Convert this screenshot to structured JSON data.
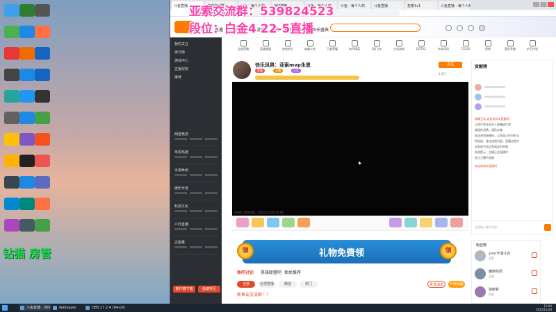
{
  "overlay": {
    "line1": "亚索交流群：539824523",
    "line2": "段位：白金4 22-5直播"
  },
  "desktop": {
    "bottom_label": "钻猫 房管",
    "icons": [
      {
        "label": "",
        "color": "#3da0e8"
      },
      {
        "label": "",
        "color": "#2e7d32"
      },
      {
        "label": "",
        "color": "#555"
      },
      {
        "label": "",
        "color": "#4caf50"
      },
      {
        "label": "",
        "color": "#1e88e5"
      },
      {
        "label": "",
        "color": "#ff7043"
      },
      {
        "label": "",
        "color": "#e53935"
      },
      {
        "label": "",
        "color": "#ef6c00"
      },
      {
        "label": "",
        "color": "#1565c0"
      },
      {
        "label": "",
        "color": "#444"
      },
      {
        "label": "",
        "color": "#1e88e5"
      },
      {
        "label": "",
        "color": "#1565c0"
      },
      {
        "label": "",
        "color": "#26a69a"
      },
      {
        "label": "",
        "color": "#2196f3"
      },
      {
        "label": "",
        "color": "#333"
      },
      {
        "label": "",
        "color": "#616161"
      },
      {
        "label": "",
        "color": "#1e88e5"
      },
      {
        "label": "",
        "color": "#43a047"
      },
      {
        "label": "",
        "color": "#ffc107"
      },
      {
        "label": "",
        "color": "#7e57c2"
      },
      {
        "label": "",
        "color": "#f4511e"
      },
      {
        "label": "",
        "color": "#ffb300"
      },
      {
        "label": "",
        "color": "#222"
      },
      {
        "label": "",
        "color": "#ef5350"
      },
      {
        "label": "",
        "color": "#37474f"
      },
      {
        "label": "",
        "color": "#1e88e5"
      },
      {
        "label": "",
        "color": "#5c6bc0"
      },
      {
        "label": "",
        "color": "#0288d1"
      },
      {
        "label": "",
        "color": "#00897b"
      },
      {
        "label": "",
        "color": "#ff7043"
      },
      {
        "label": "",
        "color": "#ab47bc"
      },
      {
        "label": "",
        "color": "#455a64"
      },
      {
        "label": "",
        "color": "#43a047"
      }
    ]
  },
  "browser": {
    "tabs": [
      "斗鱼直播",
      "亚索交流群",
      "斗鱼 - 每个人的",
      "360搜索",
      "斗鱼 - 每个人的",
      "斗鱼 - 每个人的",
      "斗鱼直播",
      "亚索1v1",
      "斗鱼直播 - 每个人的"
    ],
    "address": "https://www.douyu.com/..."
  },
  "site": {
    "nav": [
      "首页",
      "直播",
      "分类",
      "鱼吧",
      "游戏",
      "音乐",
      "视频",
      "鱼塘",
      "鱼乐盛典"
    ],
    "search_placeholder": ""
  },
  "sidebar": {
    "items": [
      "我的关注",
      "排行榜",
      "游戏中心",
      "正版授权",
      "推荐",
      "网游竞技",
      "单机热游",
      "手游休闲",
      "娱乐天地",
      "科技文化",
      "户外直播",
      "正能量"
    ],
    "buttons": [
      "客户端下载",
      "鱼塘专区"
    ]
  },
  "categories": [
    "全部直播",
    "英雄联盟",
    "绝地求生",
    "穿越火线",
    "王者荣耀",
    "和平精英",
    "QQ飞车",
    "主机游戏",
    "DOTA2",
    "永劫无间",
    "CS:GO",
    "原神",
    "星际争霸",
    "炉石传说"
  ],
  "stream": {
    "title": "快乐风男：亚索mvp永恩",
    "badges": [
      "等级",
      "主播",
      "认证"
    ],
    "follow": "关注",
    "viewers": "1.4万"
  },
  "video": {
    "meta": "房间号 5093851 · 2025/11/28 12:04"
  },
  "banner": {
    "left_coin": "领",
    "text": "礼物免费领",
    "right_coin": "领"
  },
  "below_tabs": [
    "鱼吧讨论",
    "英雄联盟吧",
    "相关推荐"
  ],
  "below_pills": [
    "全部",
    "全部直播",
    "精选",
    "热门"
  ],
  "below_buttons": [
    "发送消息",
    "开播提醒"
  ],
  "below_note": "新鱼友交流群！！",
  "rightpanel": {
    "header": "贡献榜",
    "lines": [
      "弹幕互动 欢迎来到本直播间！",
      "斗鱼严禁未成年人直播或打赏",
      "请理性消费，谨防诈骗",
      "欢迎来到直播间，斗鱼禁止任何形式",
      "的低俗、违法违规内容，直播过程中",
      "如发现不良信息请及时举报",
      "系统提示：主播正在直播中",
      "关注主播不迷路"
    ],
    "highlight": "欢迎来到本直播间",
    "input_placeholder": "这里输入聊天内容"
  },
  "fans": {
    "header": "粉丝榜",
    "rows": [
      {
        "name": "yonc不善小打",
        "sub": "亚索",
        "color": "#b0b8c0"
      },
      {
        "name": "傲娇的风",
        "sub": "亚索",
        "color": "#7a8fa8"
      },
      {
        "name": "快斩斩",
        "sub": "亚索",
        "color": "#9c7ab0"
      }
    ]
  },
  "taskbar": {
    "items": [
      "斗鱼直播 - 360",
      "Wallpaper",
      "OBS 27.2.4 (64-bit)"
    ],
    "time": "12:04",
    "date": "2025/11/28"
  }
}
